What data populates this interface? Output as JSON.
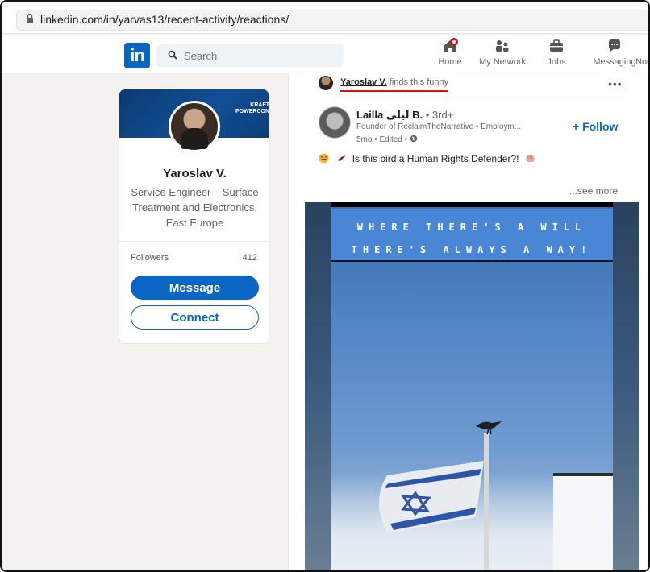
{
  "browser": {
    "url": "linkedin.com/in/yarvas13/recent-activity/reactions/"
  },
  "nav": {
    "logo": "in",
    "search_placeholder": "Search",
    "items": [
      {
        "label": "Home",
        "icon": "home-icon"
      },
      {
        "label": "My Network",
        "icon": "network-icon"
      },
      {
        "label": "Jobs",
        "icon": "briefcase-icon"
      },
      {
        "label": "Messaging",
        "icon": "messaging-icon"
      },
      {
        "label": "Not",
        "icon": "bell-icon"
      }
    ]
  },
  "profile": {
    "cover_logo_line1": "KRAFT",
    "cover_logo_line2": "POWERCON",
    "name": "Yaroslav V.",
    "headline": "Service Engineer – Surface Treatment and Electronics, East Europe",
    "followers_label": "Followers",
    "followers_count": "412",
    "message_label": "Message",
    "connect_label": "Connect"
  },
  "post": {
    "reactor_name": "Yaroslav V.",
    "reaction_text": " finds this funny",
    "more_label": "•••",
    "author_name": "Lailla ليلى B.",
    "author_degree": " • 3rd+",
    "author_headline": "Founder of ReclaimTheNarrative  •  Employm...",
    "author_meta": "5mo • Edited • ",
    "follow_label": "+ Follow",
    "text": "Is this bird a Human Rights Defender?!",
    "see_more": "...see more",
    "banner_line1": "WHERE THERE'S A WILL",
    "banner_line2": "THERE'S ALWAYS A WAY!"
  },
  "colors": {
    "brand": "#0a66c2",
    "highlight": "#dd1111"
  }
}
